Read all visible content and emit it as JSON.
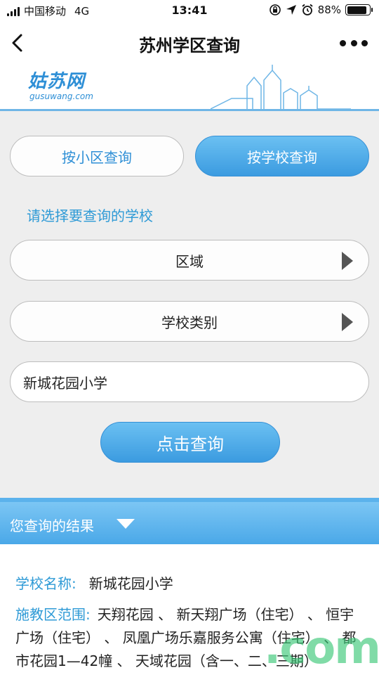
{
  "status_bar": {
    "carrier": "中国移动",
    "network": "4G",
    "time": "13:41",
    "battery_percent": "88%",
    "battery_level": 0.88
  },
  "nav": {
    "title": "苏州学区查询"
  },
  "banner": {
    "logo_main": "姑苏网",
    "logo_sub": "gusuwang.com"
  },
  "form": {
    "tab_area": "按小区查询",
    "tab_school": "按学校查询",
    "prompt": "请选择要查询的学校",
    "select_region": "区域",
    "select_type": "学校类别",
    "school_input_value": "新城花园小学",
    "query_button": "点击查询"
  },
  "results": {
    "header": "您查询的结果",
    "name_label": "学校名称:",
    "name_value": "新城花园小学",
    "district_label": "施教区范围:",
    "district_value": "天翔花园 、 新天翔广场（住宅） 、 恒宇广场（住宅） 、 凤凰广场乐嘉服务公寓（住宅） 、 都市花园1—42幢 、 天域花园（含一、二、三期）"
  },
  "watermark": {
    "text": ".com"
  },
  "colors": {
    "accent": "#3b9be0",
    "accent_light": "#6bc0f2",
    "label_blue": "#2e9ad6",
    "form_bg": "#eeeeee"
  }
}
